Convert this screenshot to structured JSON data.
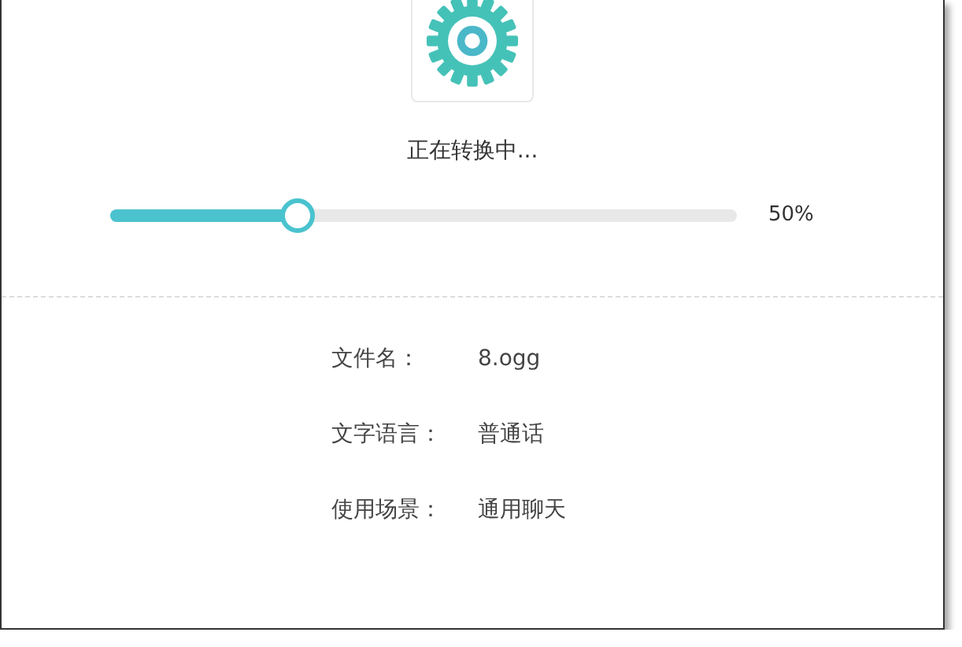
{
  "status": "正在转换中...",
  "progress": {
    "level": 0.3,
    "reading": "50%"
  },
  "details": [
    {
      "label": "文件名：",
      "value": "8.ogg"
    },
    {
      "label": "文字语言：",
      "value": "普通话"
    },
    {
      "label": "使用场景：",
      "value": "通用聊天"
    }
  ]
}
